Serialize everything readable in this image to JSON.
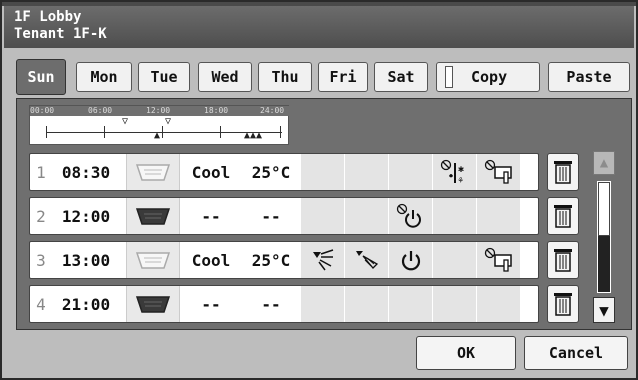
{
  "title": {
    "line1": "1F Lobby",
    "line2": "Tenant 1F-K"
  },
  "tabs": [
    {
      "label": "Sun",
      "active": true
    },
    {
      "label": "Mon"
    },
    {
      "label": "Tue"
    },
    {
      "label": "Wed"
    },
    {
      "label": "Thu"
    },
    {
      "label": "Fri"
    },
    {
      "label": "Sat"
    }
  ],
  "actions": {
    "copy_label": "Copy",
    "paste_label": "Paste"
  },
  "timeline": {
    "labels": [
      "00:00",
      "06:00",
      "12:00",
      "18:00",
      "24:00"
    ]
  },
  "schedule": [
    {
      "index": "1",
      "time": "08:30",
      "mode": "Cool",
      "temp": "25°C",
      "unit_state": "light"
    },
    {
      "index": "2",
      "time": "12:00",
      "mode": "--",
      "temp": "--",
      "unit_state": "dark"
    },
    {
      "index": "3",
      "time": "13:00",
      "mode": "Cool",
      "temp": "25°C",
      "unit_state": "light"
    },
    {
      "index": "4",
      "time": "21:00",
      "mode": "--",
      "temp": "--",
      "unit_state": "dark"
    }
  ],
  "footer": {
    "ok_label": "OK",
    "cancel_label": "Cancel"
  },
  "colors": {
    "title_bg": "#5a5a5a",
    "panel_bg": "#6f6f6f",
    "active_tab": "#6d6d6d"
  }
}
